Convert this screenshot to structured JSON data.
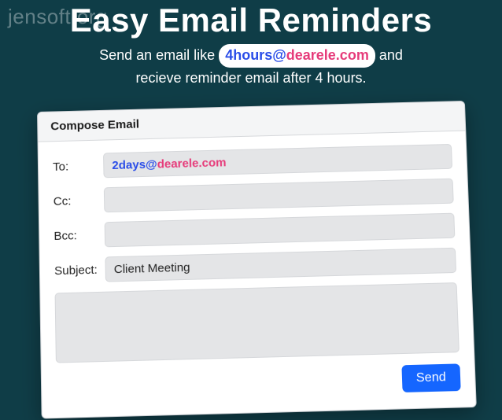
{
  "watermark": "jensoft.org",
  "hero": {
    "title": "Easy Email Reminders",
    "subtitle_pre": "Send an email like ",
    "example_local": "4hours",
    "example_at": "@",
    "example_domain": "dearele.com",
    "subtitle_mid": " and",
    "subtitle_line2": "recieve reminder email after 4 hours."
  },
  "compose": {
    "header": "Compose Email",
    "labels": {
      "to": "To:",
      "cc": "Cc:",
      "bcc": "Bcc:",
      "subject": "Subject:"
    },
    "to_local": "2days",
    "to_at": "@",
    "to_domain": "dearele.com",
    "cc_value": "",
    "bcc_value": "",
    "subject_value": "Client Meeting",
    "body_value": "",
    "send_label": "Send"
  }
}
